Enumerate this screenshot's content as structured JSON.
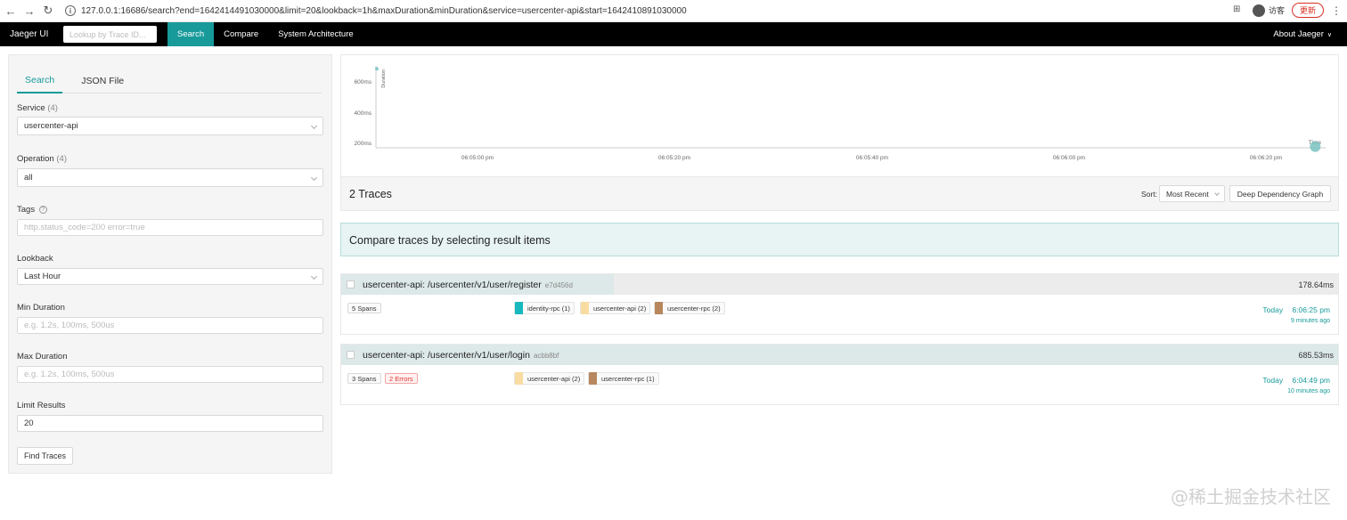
{
  "browser": {
    "url": "127.0.0.1:16686/search?end=1642414491030000&limit=20&lookback=1h&maxDuration&minDuration&service=usercenter-api&start=1642410891030000",
    "profile_label": "访客",
    "update_label": "更新"
  },
  "topbar": {
    "brand": "Jaeger UI",
    "lookup_placeholder": "Lookup by Trace ID...",
    "nav": [
      "Search",
      "Compare",
      "System Architecture"
    ],
    "about": "About Jaeger"
  },
  "search": {
    "tabs": [
      "Search",
      "JSON File"
    ],
    "service_label": "Service",
    "service_count": "(4)",
    "service_value": "usercenter-api",
    "operation_label": "Operation",
    "operation_count": "(4)",
    "operation_value": "all",
    "tags_label": "Tags",
    "tags_placeholder": "http.status_code=200 error=true",
    "lookback_label": "Lookback",
    "lookback_value": "Last Hour",
    "min_duration_label": "Min Duration",
    "min_duration_placeholder": "e.g. 1.2s, 100ms, 500us",
    "max_duration_label": "Max Duration",
    "max_duration_placeholder": "e.g. 1.2s, 100ms, 500us",
    "limit_label": "Limit Results",
    "limit_value": "20",
    "find_button": "Find Traces"
  },
  "chart_data": {
    "type": "scatter",
    "ylabel": "Duration",
    "xlabel": "Time",
    "y_ticks": [
      "600ms",
      "400ms",
      "200ms"
    ],
    "x_ticks": [
      "06:05:00 pm",
      "06:05:20 pm",
      "06:05:40 pm",
      "06:06:00 pm",
      "06:06:20 pm"
    ],
    "points": [
      {
        "x": "06:04:49 pm",
        "y": 685.53
      },
      {
        "x": "06:06:25 pm",
        "y": 178.64
      }
    ]
  },
  "results": {
    "title": "2 Traces",
    "sort_label": "Sort:",
    "sort_value": "Most Recent",
    "deep_graph": "Deep Dependency Graph",
    "compare_text": "Compare traces by selecting result items"
  },
  "traces": [
    {
      "name": "usercenter-api: /usercenter/v1/user/register",
      "id": "e7d456d",
      "duration": "178.64ms",
      "spans": "5 Spans",
      "errors": "",
      "services": [
        {
          "name": "identity-rpc (1)",
          "color": "#17b8be"
        },
        {
          "name": "usercenter-api (2)",
          "color": "#f8dca1"
        },
        {
          "name": "usercenter-rpc (2)",
          "color": "#b7885e"
        }
      ],
      "today": "Today",
      "time": "6:06:25 pm",
      "ago": "9 minutes ago"
    },
    {
      "name": "usercenter-api: /usercenter/v1/user/login",
      "id": "acbb8bf",
      "duration": "685.53ms",
      "spans": "3 Spans",
      "errors": "2 Errors",
      "services": [
        {
          "name": "usercenter-api (2)",
          "color": "#f8dca1"
        },
        {
          "name": "usercenter-rpc (1)",
          "color": "#b7885e"
        }
      ],
      "today": "Today",
      "time": "6:04:49 pm",
      "ago": "10 minutes ago"
    }
  ],
  "watermark": "@稀土掘金技术社区"
}
